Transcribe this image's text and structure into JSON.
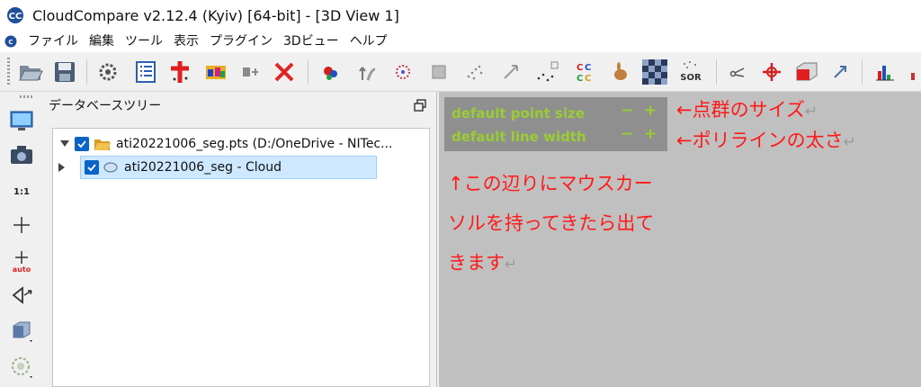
{
  "window": {
    "title": "CloudCompare v2.12.4 (Kyiv) [64-bit] - [3D View 1]"
  },
  "menubar": {
    "items": [
      "ファイル",
      "編集",
      "ツール",
      "表示",
      "プラグイン",
      "3Dビュー",
      "ヘルプ"
    ]
  },
  "db_tree": {
    "title": "データベースツリー",
    "items": [
      {
        "label": "ati20221006_seg.pts (D:/OneDrive - NITec..."
      },
      {
        "label": "ati20221006_seg - Cloud"
      }
    ]
  },
  "view3d": {
    "point_size_label": "default point size",
    "line_width_label": "default line width",
    "minus_symbol": "−",
    "plus_symbol": "+",
    "annotation_point": "←点群のサイズ",
    "annotation_line": "←ポリラインの太さ",
    "annotation_hint": [
      "↑この辺りにマウスカー",
      "ソルを持ってきたら出て",
      "きます"
    ],
    "return_mark": "↵"
  },
  "colors": {
    "overlay_text": "#9acd32",
    "annotation": "#ff1a1a",
    "view_background": "#c0c0c0",
    "checkbox": "#0a64c8"
  }
}
